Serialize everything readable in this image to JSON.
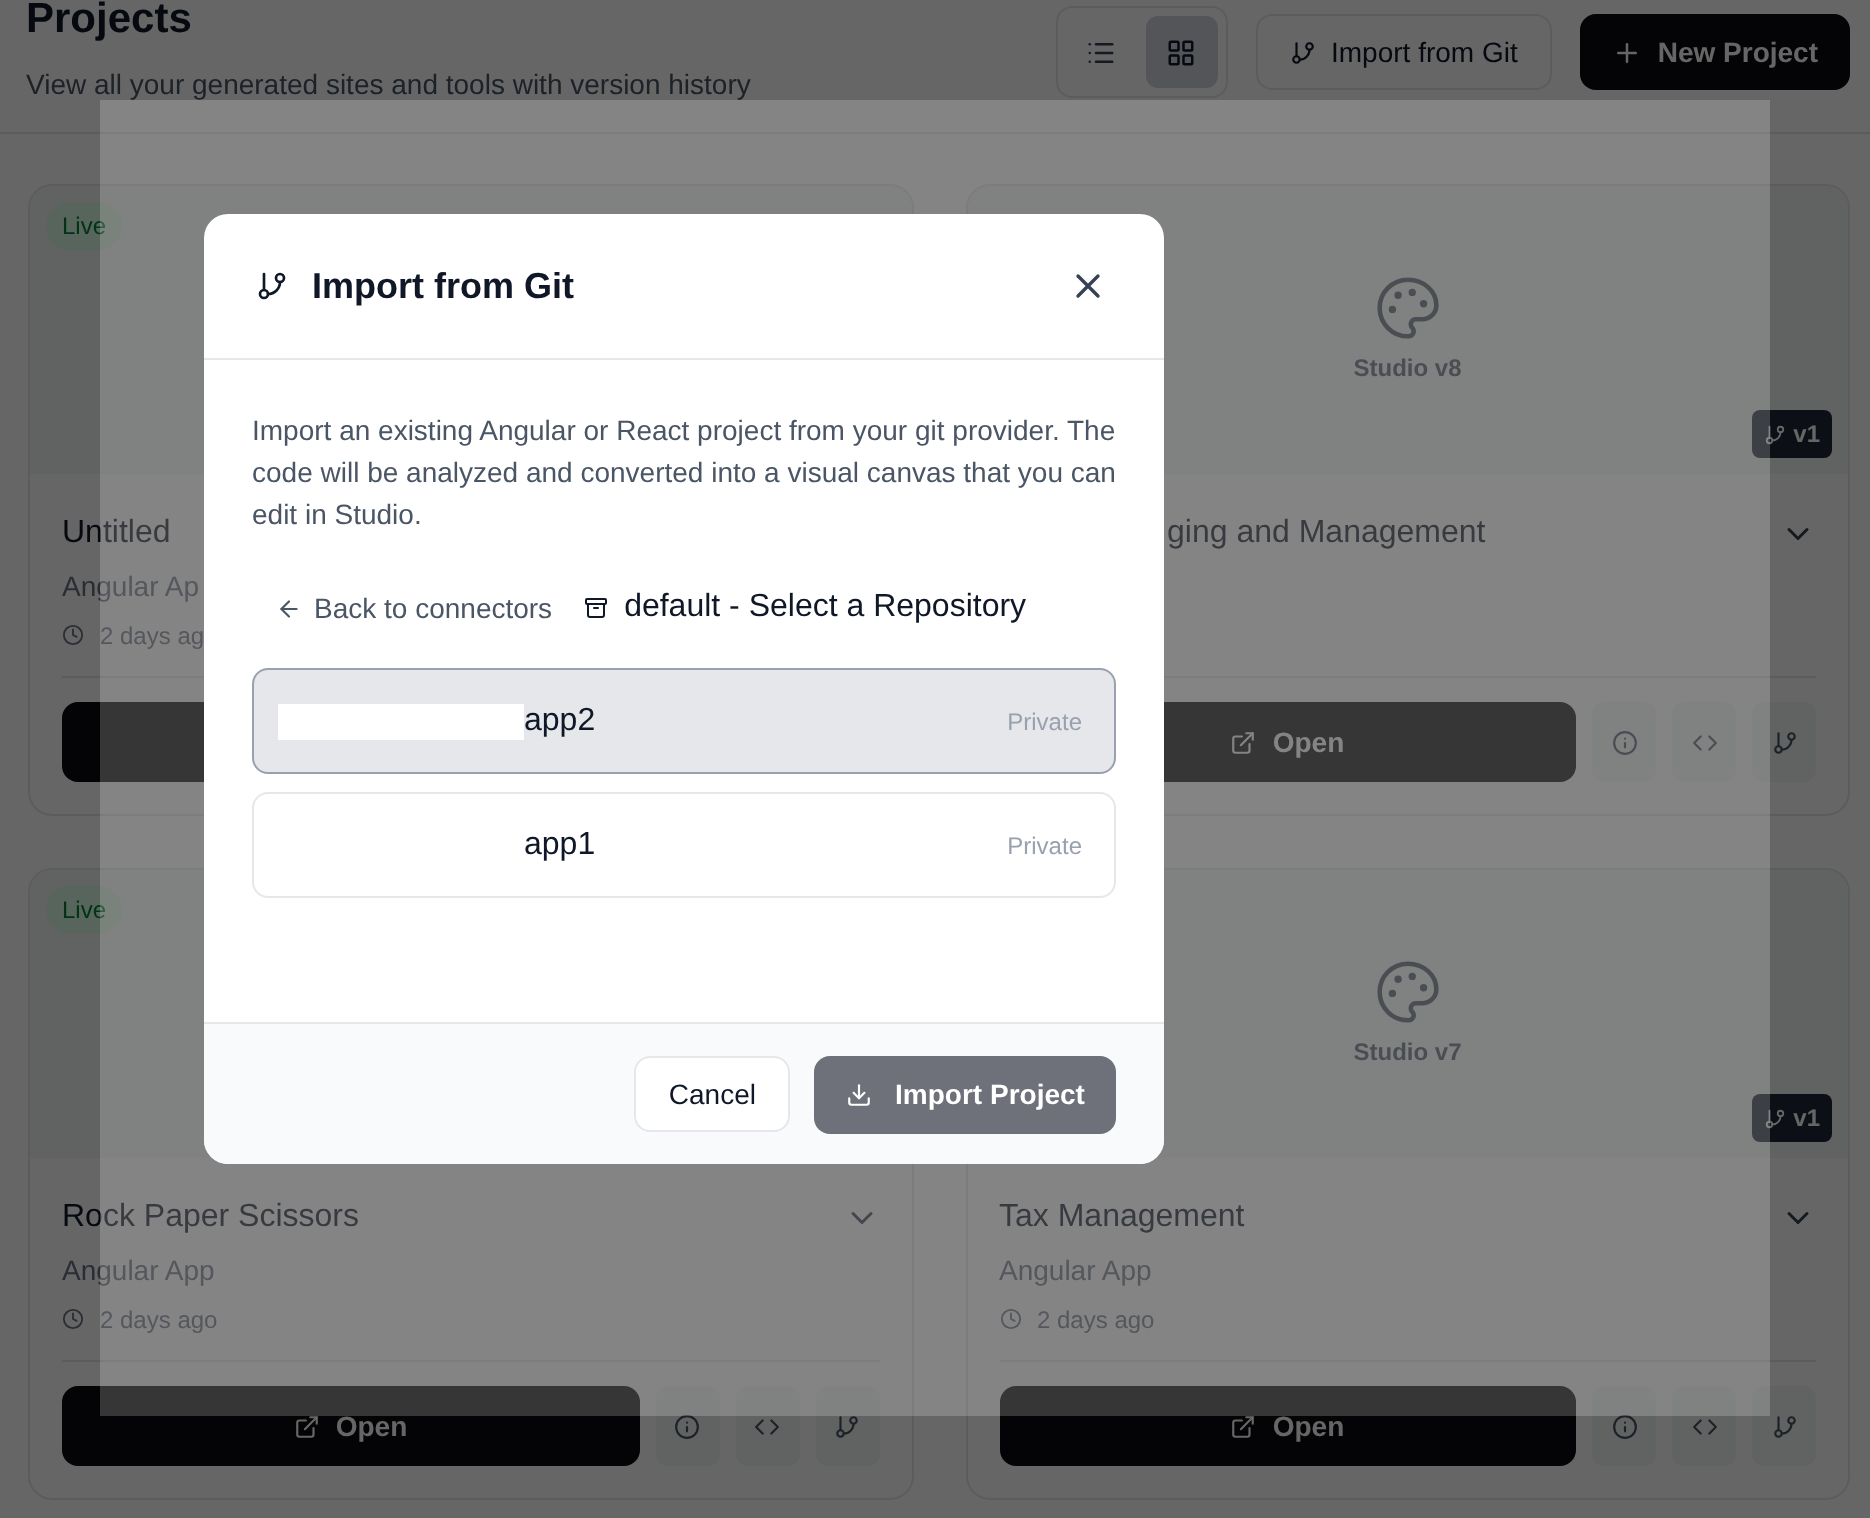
{
  "header": {
    "title": "Projects",
    "subtitle": "View all your generated sites and tools with version history",
    "view_toggle": [
      {
        "kind": "list",
        "selected": false
      },
      {
        "kind": "grid",
        "selected": true
      }
    ],
    "import_button": "Import from Git",
    "new_button": "New Project"
  },
  "cards": [
    {
      "badge": "Live",
      "title": "Untitled",
      "subtitle": "Angular Ap",
      "time": "2 days ag"
    },
    {
      "studio_label": "Studio v8",
      "version": "v1",
      "title": "ging and Management",
      "expanded": false,
      "open_label": "Open"
    },
    {
      "badge": "Live",
      "title": "Rock Paper Scissors",
      "subtitle": "Angular App",
      "time": "2 days ago",
      "expanded": false,
      "open_label": "Open"
    },
    {
      "studio_label": "Studio v7",
      "version": "v1",
      "title": "Tax Management",
      "subtitle": "Angular App",
      "time": "2 days ago",
      "expanded": false,
      "open_label": "Open"
    }
  ],
  "modal": {
    "title": "Import from Git",
    "description": "Import an existing Angular or React project from your git provider. The code will be analyzed and converted into a visual canvas that you can edit in Studio.",
    "back_link": "Back to connectors",
    "source_title": "default - Select a Repository",
    "repositories": [
      {
        "name": "app2",
        "visibility": "Private",
        "selected": true
      },
      {
        "name": "app1",
        "visibility": "Private",
        "selected": false
      }
    ],
    "cancel_button": "Cancel",
    "import_button": {
      "label": "Import Project",
      "disabled": true
    }
  }
}
